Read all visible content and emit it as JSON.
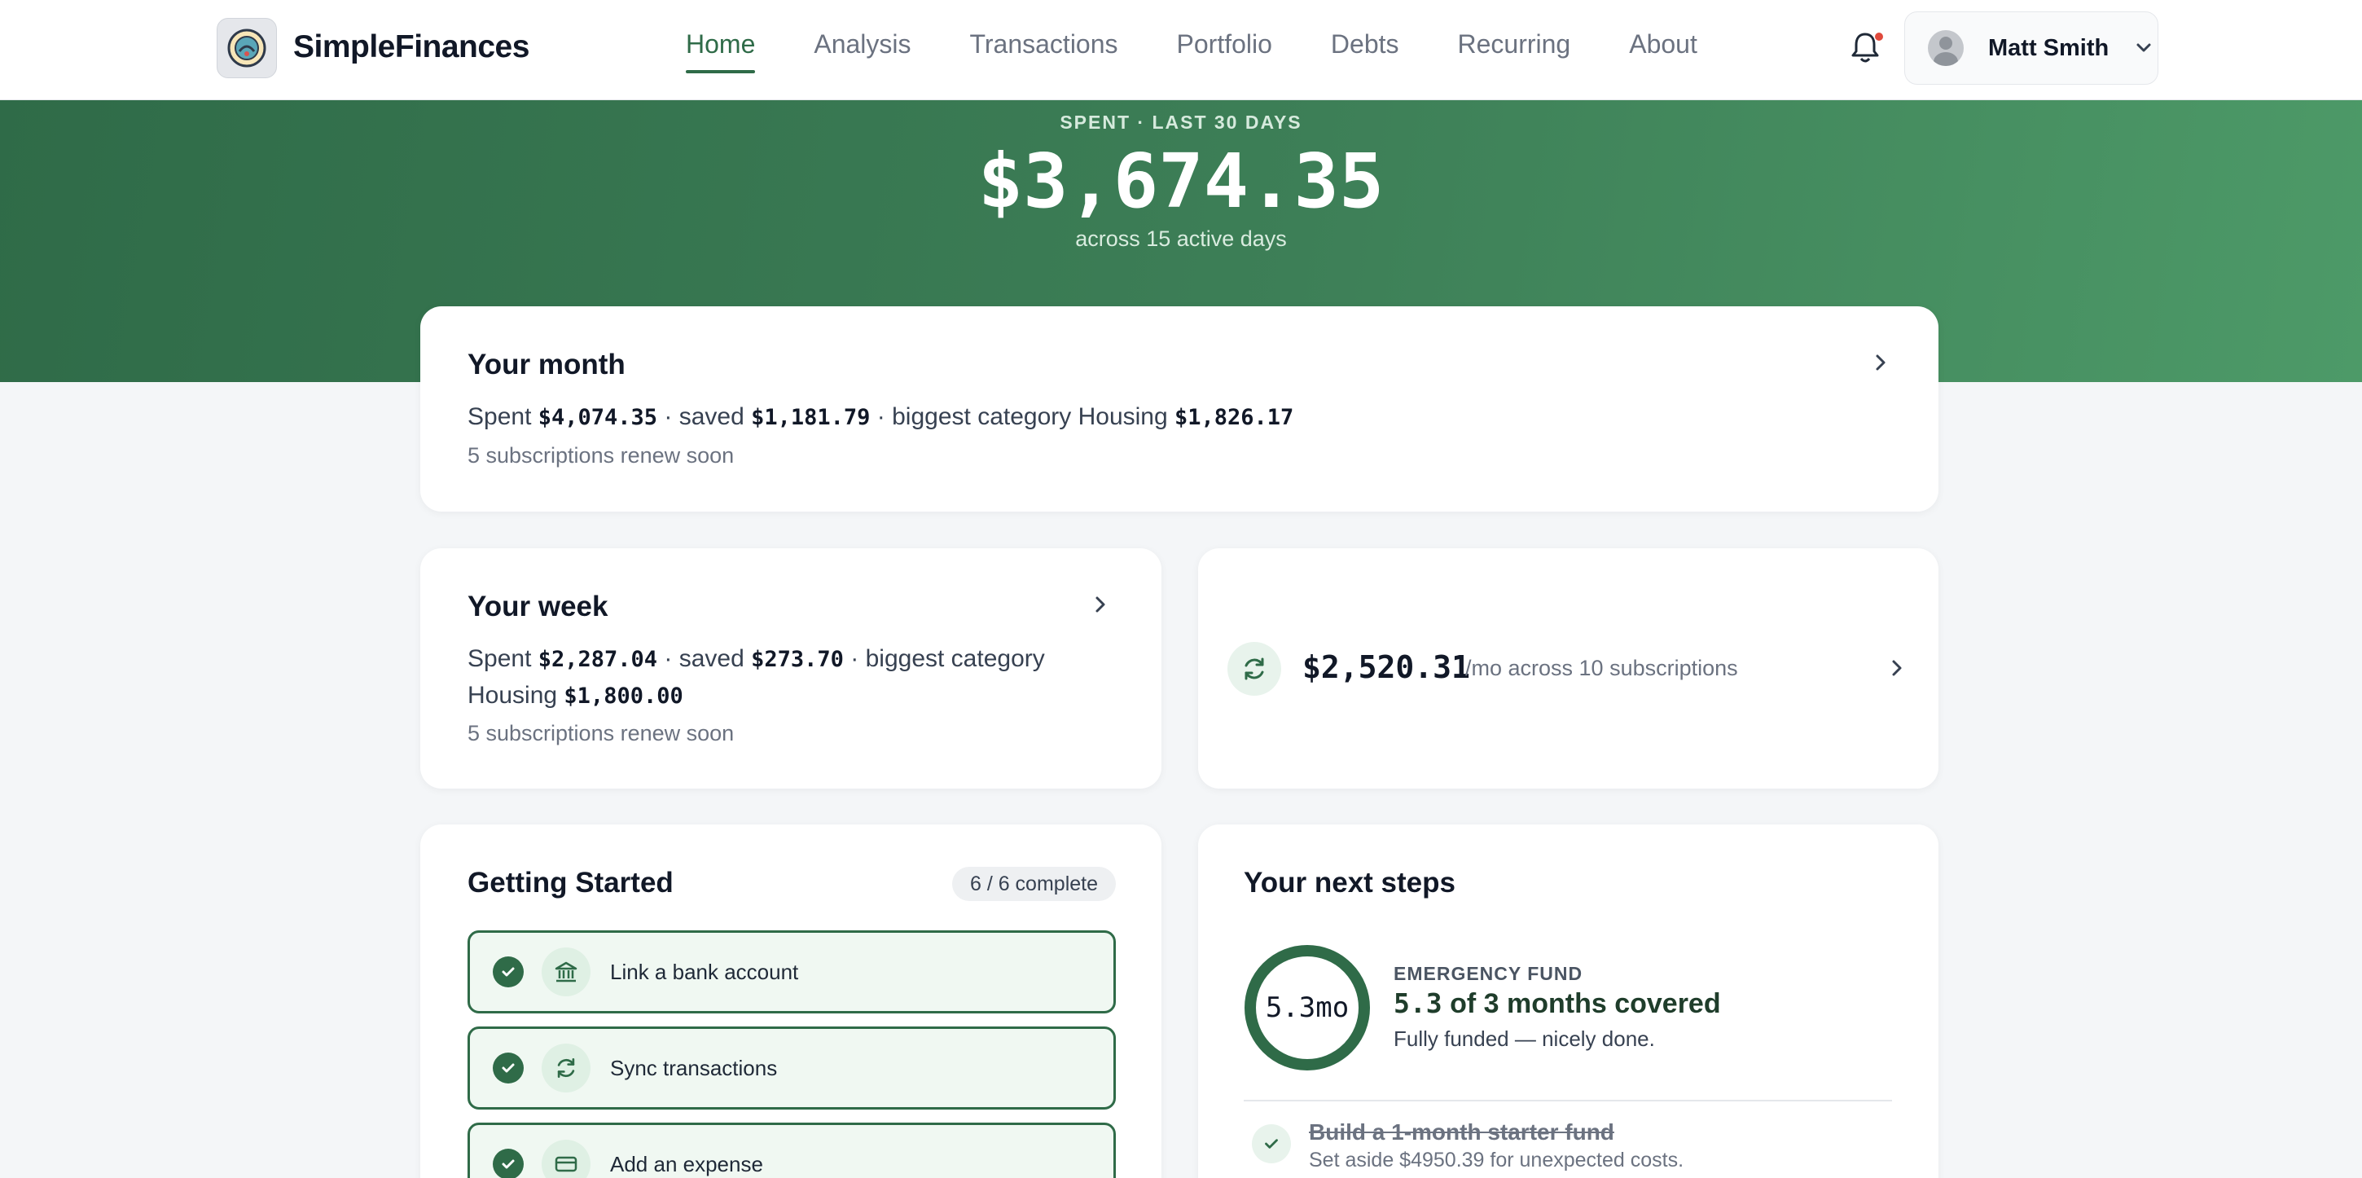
{
  "brand": {
    "name": "SimpleFinances",
    "logo_icon": "logo-icon"
  },
  "nav": {
    "links": [
      "Home",
      "Analysis",
      "Transactions",
      "Portfolio",
      "Debts",
      "Recurring",
      "About"
    ],
    "active": "Home"
  },
  "user": {
    "name": "Matt Smith"
  },
  "hero": {
    "label": "SPENT · LAST 30 DAYS",
    "amount": "$3,674.35",
    "subtitle": "across 15 active days"
  },
  "month": {
    "title": "Your month",
    "spent_prefix": "Spent",
    "spent": "$4,074.35",
    "saved_prefix": "· saved",
    "saved": "$1,181.79",
    "category_prefix": "· biggest category Housing",
    "category_amount": "$1,826.17",
    "note": "5 subscriptions renew soon"
  },
  "week": {
    "title": "Your week",
    "spent_prefix": "Spent",
    "spent": "$2,287.04",
    "saved_prefix": "· saved",
    "saved": "$273.70",
    "category_prefix": "· biggest category",
    "category_name": "Housing",
    "category_amount": "$1,800.00",
    "note": "5 subscriptions renew soon"
  },
  "subscriptions": {
    "amount": "$2,520.31",
    "note": "/mo across 10 subscriptions"
  },
  "getting_started": {
    "title": "Getting Started",
    "badge": "6 / 6 complete",
    "tasks": [
      {
        "label": "Link a bank account",
        "icon": "bank-icon"
      },
      {
        "label": "Sync transactions",
        "icon": "sync-icon"
      },
      {
        "label": "Add an expense",
        "icon": "card-icon"
      }
    ]
  },
  "next_steps": {
    "title": "Your next steps",
    "ring_text": "5.3mo",
    "ring_progress": 1.0,
    "label": "EMERGENCY FUND",
    "covered": "5.3",
    "of_text": "of",
    "target": "3",
    "months_text": "months covered",
    "status": "Fully funded — nicely done.",
    "step_title": "Build a 1-month starter fund",
    "step_sub": "Set aside $4950.39 for unexpected costs."
  },
  "colors": {
    "accent": "#2f6b48",
    "hero_start": "#2f6b48",
    "hero_end": "#4d9a68",
    "alert_dot": "#e04a3c"
  }
}
